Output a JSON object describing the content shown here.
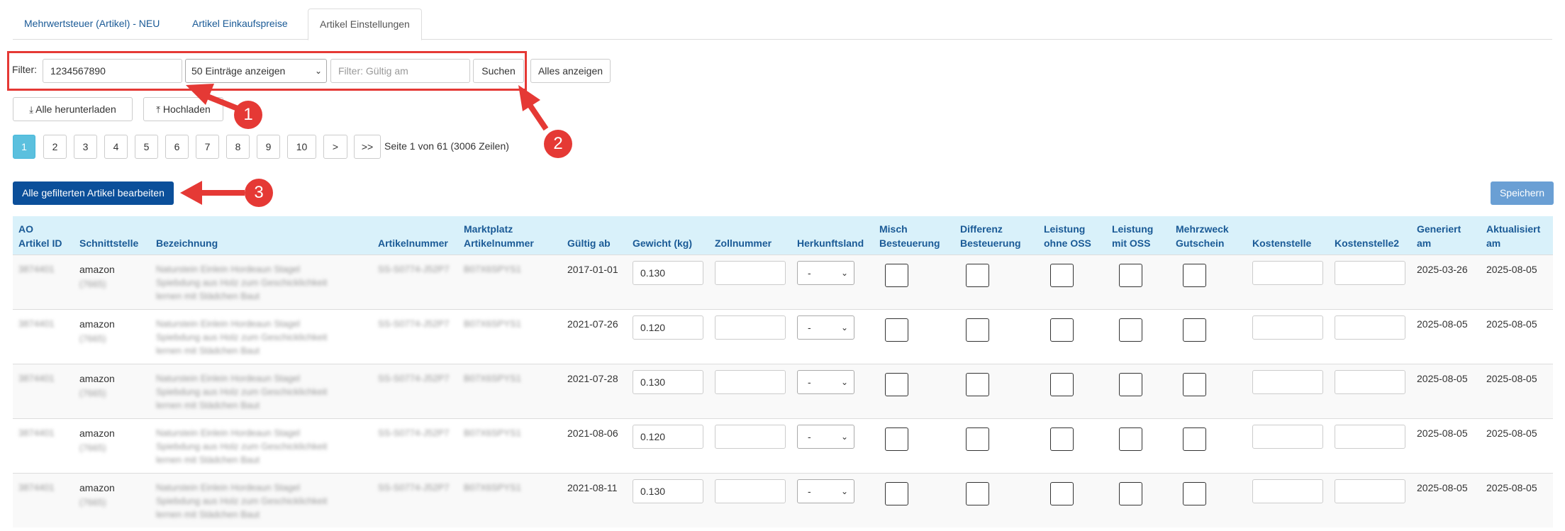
{
  "tabs": [
    {
      "label": "Mehrwertsteuer (Artikel) - NEU"
    },
    {
      "label": "Artikel Einkaufspreise"
    },
    {
      "label": "Artikel Einstellungen"
    }
  ],
  "filter": {
    "label": "Filter:",
    "value": "1234567890",
    "entries_select": "50 Einträge anzeigen",
    "date_placeholder": "Filter: Gültig am",
    "search_label": "Suchen",
    "show_all_label": "Alles anzeigen"
  },
  "actions": {
    "download_label": "Alle herunterladen",
    "upload_label": "Hochladen",
    "edit_all_label": "Alle gefilterten Artikel bearbeiten",
    "save_label": "Speichern"
  },
  "pagination": {
    "pages": [
      "1",
      "2",
      "3",
      "4",
      "5",
      "6",
      "7",
      "8",
      "9",
      "10",
      ">",
      ">>"
    ],
    "current": "1",
    "info": "Seite 1 von 61 (3006 Zeilen)"
  },
  "annotations": [
    "1",
    "2",
    "3"
  ],
  "table": {
    "headers": {
      "ao_id": [
        "AO",
        "Artikel ID"
      ],
      "schnittstelle": "Schnittstelle",
      "bezeichnung": "Bezeichnung",
      "artikelnummer": "Artikelnummer",
      "marktplatz": [
        "Marktplatz",
        "Artikelnummer"
      ],
      "gueltig": "Gültig ab",
      "gewicht": "Gewicht (kg)",
      "zollnummer": "Zollnummer",
      "herkunftsland": "Herkunftsland",
      "misch": [
        "Misch",
        "Besteuerung"
      ],
      "differenz": [
        "Differenz",
        "Besteuerung"
      ],
      "ohne_oss": [
        "Leistung",
        "ohne OSS"
      ],
      "mit_oss": [
        "Leistung",
        "mit OSS"
      ],
      "mehrzweck": [
        "Mehrzweck",
        "Gutschein"
      ],
      "kostenstelle": "Kostenstelle",
      "kostenstelle2": "Kostenstelle2",
      "generiert": [
        "Generiert",
        "am"
      ],
      "aktualisiert": [
        "Aktualisiert",
        "am"
      ]
    },
    "rows": [
      {
        "ao_id": "3874401",
        "schnittstelle": "amazon",
        "schnittstelle_sub": "(7665)",
        "bez": [
          "Naturstein Einlein Hordeaun Stagel",
          "Spiebdung aus Holz zum Geschicklichkeit",
          "lernen mit Städchen Baut"
        ],
        "artnr": "SS-S0774-J52P7",
        "mpnr": "B07X6SPYS1",
        "gueltig": "2017-01-01",
        "gewicht": "0.130",
        "herkunft": "-",
        "generiert": "2025-03-26",
        "aktualisiert": "2025-08-05"
      },
      {
        "ao_id": "3874401",
        "schnittstelle": "amazon",
        "schnittstelle_sub": "(7665)",
        "bez": [
          "Naturstein Einlein Hordeaun Stagel",
          "Spiebdung aus Holz zum Geschicklichkeit",
          "lernen mit Städchen Baut"
        ],
        "artnr": "SS-S0774-J52P7",
        "mpnr": "B07X6SPYS1",
        "gueltig": "2021-07-26",
        "gewicht": "0.120",
        "herkunft": "-",
        "generiert": "2025-08-05",
        "aktualisiert": "2025-08-05"
      },
      {
        "ao_id": "3874401",
        "schnittstelle": "amazon",
        "schnittstelle_sub": "(7665)",
        "bez": [
          "Naturstein Einlein Hordeaun Stagel",
          "Spiebdung aus Holz zum Geschicklichkeit",
          "lernen mit Städchen Baut"
        ],
        "artnr": "SS-S0774-J52P7",
        "mpnr": "B07X6SPYS1",
        "gueltig": "2021-07-28",
        "gewicht": "0.130",
        "herkunft": "-",
        "generiert": "2025-08-05",
        "aktualisiert": "2025-08-05"
      },
      {
        "ao_id": "3874401",
        "schnittstelle": "amazon",
        "schnittstelle_sub": "(7665)",
        "bez": [
          "Naturstein Einlein Hordeaun Stagel",
          "Spiebdung aus Holz zum Geschicklichkeit",
          "lernen mit Städchen Baut"
        ],
        "artnr": "SS-S0774-J52P7",
        "mpnr": "B07X6SPYS1",
        "gueltig": "2021-08-06",
        "gewicht": "0.120",
        "herkunft": "-",
        "generiert": "2025-08-05",
        "aktualisiert": "2025-08-05"
      },
      {
        "ao_id": "3874401",
        "schnittstelle": "amazon",
        "schnittstelle_sub": "(7665)",
        "bez": [
          "Naturstein Einlein Hordeaun Stagel",
          "Spiebdung aus Holz zum Geschicklichkeit",
          "lernen mit Städchen Baut"
        ],
        "artnr": "SS-S0774-J52P7",
        "mpnr": "B07X6SPYS1",
        "gueltig": "2021-08-11",
        "gewicht": "0.130",
        "herkunft": "-",
        "generiert": "2025-08-05",
        "aktualisiert": "2025-08-05"
      }
    ]
  }
}
